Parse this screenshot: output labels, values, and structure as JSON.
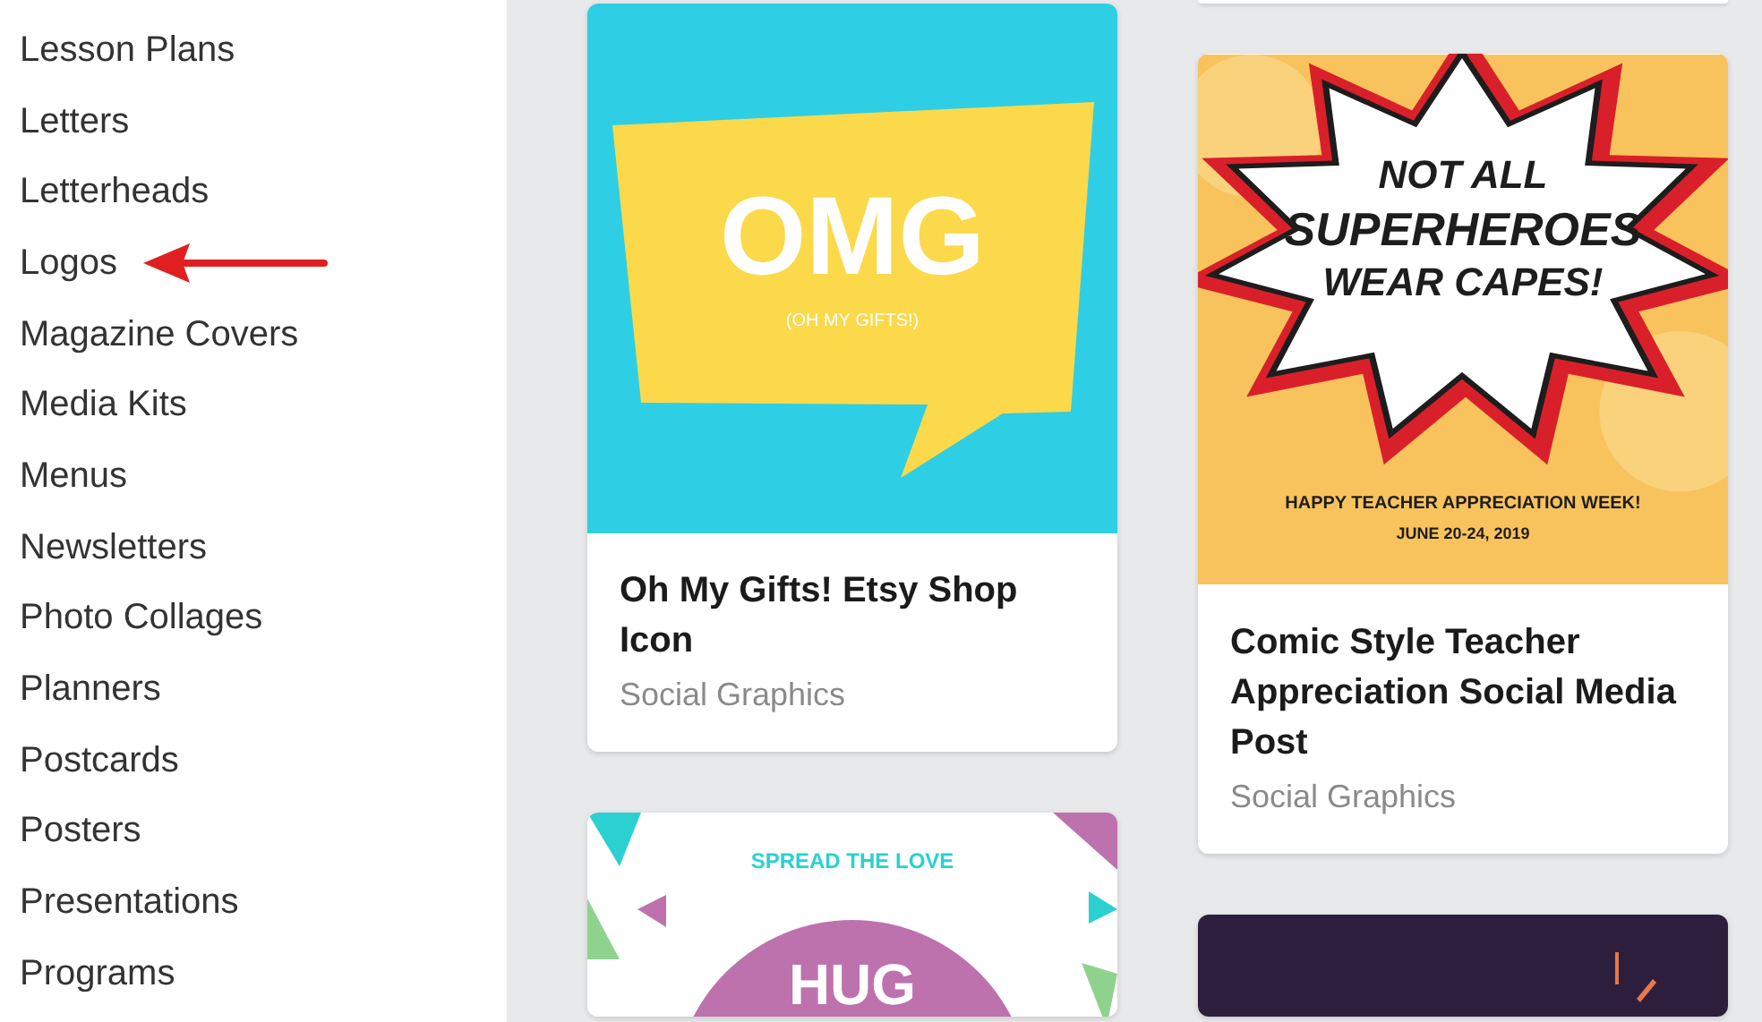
{
  "sidebar": {
    "items": [
      {
        "label": "Lesson Plans",
        "highlighted": false
      },
      {
        "label": "Letters",
        "highlighted": false
      },
      {
        "label": "Letterheads",
        "highlighted": false
      },
      {
        "label": "Logos",
        "highlighted": true
      },
      {
        "label": "Magazine Covers",
        "highlighted": false
      },
      {
        "label": "Media Kits",
        "highlighted": false
      },
      {
        "label": "Menus",
        "highlighted": false
      },
      {
        "label": "Newsletters",
        "highlighted": false
      },
      {
        "label": "Photo Collages",
        "highlighted": false
      },
      {
        "label": "Planners",
        "highlighted": false
      },
      {
        "label": "Postcards",
        "highlighted": false
      },
      {
        "label": "Posters",
        "highlighted": false
      },
      {
        "label": "Presentations",
        "highlighted": false
      },
      {
        "label": "Programs",
        "highlighted": false
      }
    ]
  },
  "columns": [
    [
      {
        "kind": "omg",
        "title": "Oh My Gifts! Etsy Shop Icon",
        "category": "Social Graphics",
        "art": [
          "OMG",
          "(OH MY GIFTS!)"
        ]
      },
      {
        "kind": "hug",
        "art": [
          "SPREAD THE LOVE",
          "HUG"
        ]
      }
    ],
    [
      {
        "kind": "comic",
        "title": "Comic Style Teacher Appreciation Social Media Post",
        "category": "Social Graphics",
        "art": [
          "NOT ALL",
          "SUPERHEROES",
          "WEAR CAPES!",
          "HAPPY TEACHER APPRECIATION WEEK!",
          "JUNE 20-24, 2019"
        ]
      },
      {
        "kind": "dark"
      }
    ]
  ]
}
